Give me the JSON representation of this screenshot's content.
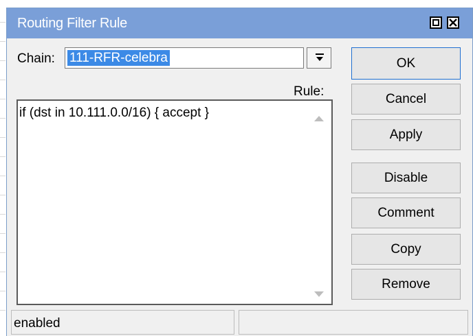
{
  "window": {
    "title": "Routing Filter Rule"
  },
  "form": {
    "chain_label": "Chain:",
    "chain_value": "111-RFR-celebra",
    "rule_label": "Rule:",
    "rule_text": "if (dst in 10.111.0.0/16) { accept }"
  },
  "buttons": {
    "ok": "OK",
    "cancel": "Cancel",
    "apply": "Apply",
    "disable": "Disable",
    "comment": "Comment",
    "copy": "Copy",
    "remove": "Remove"
  },
  "status": {
    "left": "enabled",
    "right": ""
  },
  "icons": {
    "restore": "restore-icon",
    "close": "close-icon",
    "dropdown": "dropdown-arrow-icon",
    "scroll_up": "scroll-up-icon",
    "scroll_down": "scroll-down-icon"
  },
  "colors": {
    "titlebar": "#7a9fd8",
    "selection": "#3c8ae6",
    "default_button_border": "#1f6fd1"
  }
}
